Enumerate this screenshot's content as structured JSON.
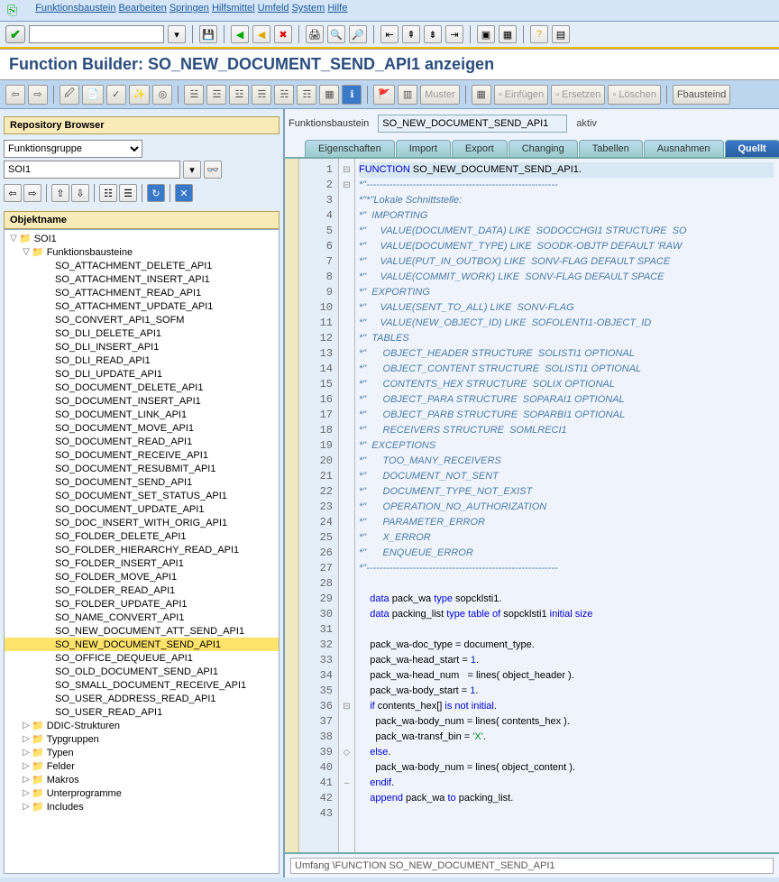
{
  "menu": [
    "Funktionsbaustein",
    "Bearbeiten",
    "Springen",
    "Hilfsmittel",
    "Umfeld",
    "System",
    "Hilfe"
  ],
  "title": "Function Builder: SO_NEW_DOCUMENT_SEND_API1 anzeigen",
  "toolbar2": {
    "muster": "Muster",
    "einfugen": "Einfügen",
    "ersetzen": "Ersetzen",
    "loschen": "Löschen",
    "fbausteind": "Fbausteind"
  },
  "repo": {
    "header": "Repository Browser",
    "group": "Funktionsgruppe",
    "value": "SOI1",
    "obj_header": "Objektname"
  },
  "tree": {
    "root": "SOI1",
    "fb": "Funktionsbausteine",
    "items": [
      "SO_ATTACHMENT_DELETE_API1",
      "SO_ATTACHMENT_INSERT_API1",
      "SO_ATTACHMENT_READ_API1",
      "SO_ATTACHMENT_UPDATE_API1",
      "SO_CONVERT_API1_SOFM",
      "SO_DLI_DELETE_API1",
      "SO_DLI_INSERT_API1",
      "SO_DLI_READ_API1",
      "SO_DLI_UPDATE_API1",
      "SO_DOCUMENT_DELETE_API1",
      "SO_DOCUMENT_INSERT_API1",
      "SO_DOCUMENT_LINK_API1",
      "SO_DOCUMENT_MOVE_API1",
      "SO_DOCUMENT_READ_API1",
      "SO_DOCUMENT_RECEIVE_API1",
      "SO_DOCUMENT_RESUBMIT_API1",
      "SO_DOCUMENT_SEND_API1",
      "SO_DOCUMENT_SET_STATUS_API1",
      "SO_DOCUMENT_UPDATE_API1",
      "SO_DOC_INSERT_WITH_ORIG_API1",
      "SO_FOLDER_DELETE_API1",
      "SO_FOLDER_HIERARCHY_READ_API1",
      "SO_FOLDER_INSERT_API1",
      "SO_FOLDER_MOVE_API1",
      "SO_FOLDER_READ_API1",
      "SO_FOLDER_UPDATE_API1",
      "SO_NAME_CONVERT_API1",
      "SO_NEW_DOCUMENT_ATT_SEND_API1",
      "SO_NEW_DOCUMENT_SEND_API1",
      "SO_OFFICE_DEQUEUE_API1",
      "SO_OLD_DOCUMENT_SEND_API1",
      "SO_SMALL_DOCUMENT_RECEIVE_API1",
      "SO_USER_ADDRESS_READ_API1",
      "SO_USER_READ_API1"
    ],
    "selected": "SO_NEW_DOCUMENT_SEND_API1",
    "folders": [
      "DDIC-Strukturen",
      "Typgruppen",
      "Typen",
      "Felder",
      "Makros",
      "Unterprogramme",
      "Includes"
    ]
  },
  "fb": {
    "label": "Funktionsbaustein",
    "value": "SO_NEW_DOCUMENT_SEND_API1",
    "status": "aktiv"
  },
  "tabs": [
    "Eigenschaften",
    "Import",
    "Export",
    "Changing",
    "Tabellen",
    "Ausnahmen",
    "Quellt"
  ],
  "active_tab": 6,
  "status": "Umfang \\FUNCTION SO_NEW_DOCUMENT_SEND_API1",
  "code": {
    "lines": [
      {
        "n": 1,
        "t": "FUNCTION SO_NEW_DOCUMENT_SEND_API1.",
        "hl": true,
        "kw": [
          "FUNCTION"
        ]
      },
      {
        "n": 2,
        "t": "*\"----------------------------------------------------------",
        "cm": true
      },
      {
        "n": 3,
        "t": "*\"*\"Lokale Schnittstelle:",
        "cm": true
      },
      {
        "n": 4,
        "t": "*\"  IMPORTING",
        "cm": true
      },
      {
        "n": 5,
        "t": "*\"     VALUE(DOCUMENT_DATA) LIKE  SODOCCHGI1 STRUCTURE  SO",
        "cm": true
      },
      {
        "n": 6,
        "t": "*\"     VALUE(DOCUMENT_TYPE) LIKE  SOODK-OBJTP DEFAULT 'RAW",
        "cm": true
      },
      {
        "n": 7,
        "t": "*\"     VALUE(PUT_IN_OUTBOX) LIKE  SONV-FLAG DEFAULT SPACE",
        "cm": true
      },
      {
        "n": 8,
        "t": "*\"     VALUE(COMMIT_WORK) LIKE  SONV-FLAG DEFAULT SPACE",
        "cm": true
      },
      {
        "n": 9,
        "t": "*\"  EXPORTING",
        "cm": true
      },
      {
        "n": 10,
        "t": "*\"     VALUE(SENT_TO_ALL) LIKE  SONV-FLAG",
        "cm": true
      },
      {
        "n": 11,
        "t": "*\"     VALUE(NEW_OBJECT_ID) LIKE  SOFOLENTI1-OBJECT_ID",
        "cm": true
      },
      {
        "n": 12,
        "t": "*\"  TABLES",
        "cm": true
      },
      {
        "n": 13,
        "t": "*\"      OBJECT_HEADER STRUCTURE  SOLISTI1 OPTIONAL",
        "cm": true
      },
      {
        "n": 14,
        "t": "*\"      OBJECT_CONTENT STRUCTURE  SOLISTI1 OPTIONAL",
        "cm": true
      },
      {
        "n": 15,
        "t": "*\"      CONTENTS_HEX STRUCTURE  SOLIX OPTIONAL",
        "cm": true
      },
      {
        "n": 16,
        "t": "*\"      OBJECT_PARA STRUCTURE  SOPARAI1 OPTIONAL",
        "cm": true
      },
      {
        "n": 17,
        "t": "*\"      OBJECT_PARB STRUCTURE  SOPARBI1 OPTIONAL",
        "cm": true
      },
      {
        "n": 18,
        "t": "*\"      RECEIVERS STRUCTURE  SOMLRECI1",
        "cm": true
      },
      {
        "n": 19,
        "t": "*\"  EXCEPTIONS",
        "cm": true
      },
      {
        "n": 20,
        "t": "*\"      TOO_MANY_RECEIVERS",
        "cm": true
      },
      {
        "n": 21,
        "t": "*\"      DOCUMENT_NOT_SENT",
        "cm": true
      },
      {
        "n": 22,
        "t": "*\"      DOCUMENT_TYPE_NOT_EXIST",
        "cm": true
      },
      {
        "n": 23,
        "t": "*\"      OPERATION_NO_AUTHORIZATION",
        "cm": true
      },
      {
        "n": 24,
        "t": "*\"      PARAMETER_ERROR",
        "cm": true
      },
      {
        "n": 25,
        "t": "*\"      X_ERROR",
        "cm": true
      },
      {
        "n": 26,
        "t": "*\"      ENQUEUE_ERROR",
        "cm": true
      },
      {
        "n": 27,
        "t": "*\"----------------------------------------------------------",
        "cm": true
      },
      {
        "n": 28,
        "t": ""
      },
      {
        "n": 29,
        "t": "    data pack_wa type sopcklsti1.",
        "kw": [
          "data",
          "type"
        ]
      },
      {
        "n": 30,
        "t": "    data packing_list type table of sopcklsti1 initial size",
        "kw": [
          "data",
          "type",
          "table",
          "of",
          "initial",
          "size"
        ]
      },
      {
        "n": 31,
        "t": ""
      },
      {
        "n": 32,
        "t": "    pack_wa-doc_type = document_type."
      },
      {
        "n": 33,
        "t": "    pack_wa-head_start = 1.",
        "num": [
          "1"
        ]
      },
      {
        "n": 34,
        "t": "    pack_wa-head_num   = lines( object_header )."
      },
      {
        "n": 35,
        "t": "    pack_wa-body_start = 1.",
        "num": [
          "1"
        ]
      },
      {
        "n": 36,
        "t": "    if contents_hex[] is not initial.",
        "kw": [
          "if",
          "is",
          "not",
          "initial"
        ]
      },
      {
        "n": 37,
        "t": "      pack_wa-body_num = lines( contents_hex )."
      },
      {
        "n": 38,
        "t": "      pack_wa-transf_bin = 'X'.",
        "str": [
          "'X'"
        ]
      },
      {
        "n": 39,
        "t": "    else.",
        "kw": [
          "else"
        ]
      },
      {
        "n": 40,
        "t": "      pack_wa-body_num = lines( object_content )."
      },
      {
        "n": 41,
        "t": "    endif.",
        "kw": [
          "endif"
        ]
      },
      {
        "n": 42,
        "t": "    append pack_wa to packing_list.",
        "kw": [
          "append",
          "to"
        ]
      },
      {
        "n": 43,
        "t": ""
      }
    ],
    "fold": {
      "1": "⊟",
      "2": "⊟",
      "36": "⊟",
      "39": "◇",
      "41": "–"
    }
  }
}
